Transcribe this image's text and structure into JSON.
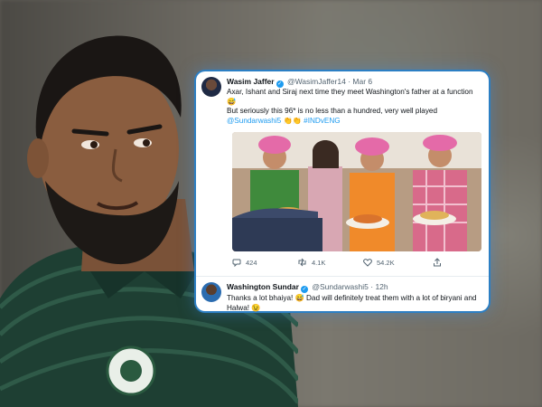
{
  "tweet": {
    "author_name": "Wasim Jaffer",
    "handle": "@WasimJaffer14",
    "separator": "·",
    "date": "Mar 6",
    "line1": "Axar, Ishant and Siraj next time they meet Washington's father at a function 😅",
    "line2": "But seriously this 96* is no less than a hundred, very well played",
    "mention": "@Sundarwashi5",
    "clap_emoji": "👏👏",
    "hashtag": "#INDvENG",
    "replies": "424",
    "retweets": "4.1K",
    "likes": "54.2K"
  },
  "reply": {
    "author_name": "Washington Sundar",
    "handle": "@Sundarwashi5",
    "separator": "·",
    "time": "12h",
    "text": "Thanks a lot bhaiya! 😅 Dad will definitely treat them with a lot of biryani and Halwa! 😉"
  },
  "colors": {
    "link_blue": "#1d9bf0",
    "card_border": "#2c7fc4",
    "turban_pink": "#e46aa8"
  },
  "icons": [
    "verified-badge-icon",
    "reply-icon",
    "retweet-icon",
    "like-icon",
    "share-icon"
  ]
}
